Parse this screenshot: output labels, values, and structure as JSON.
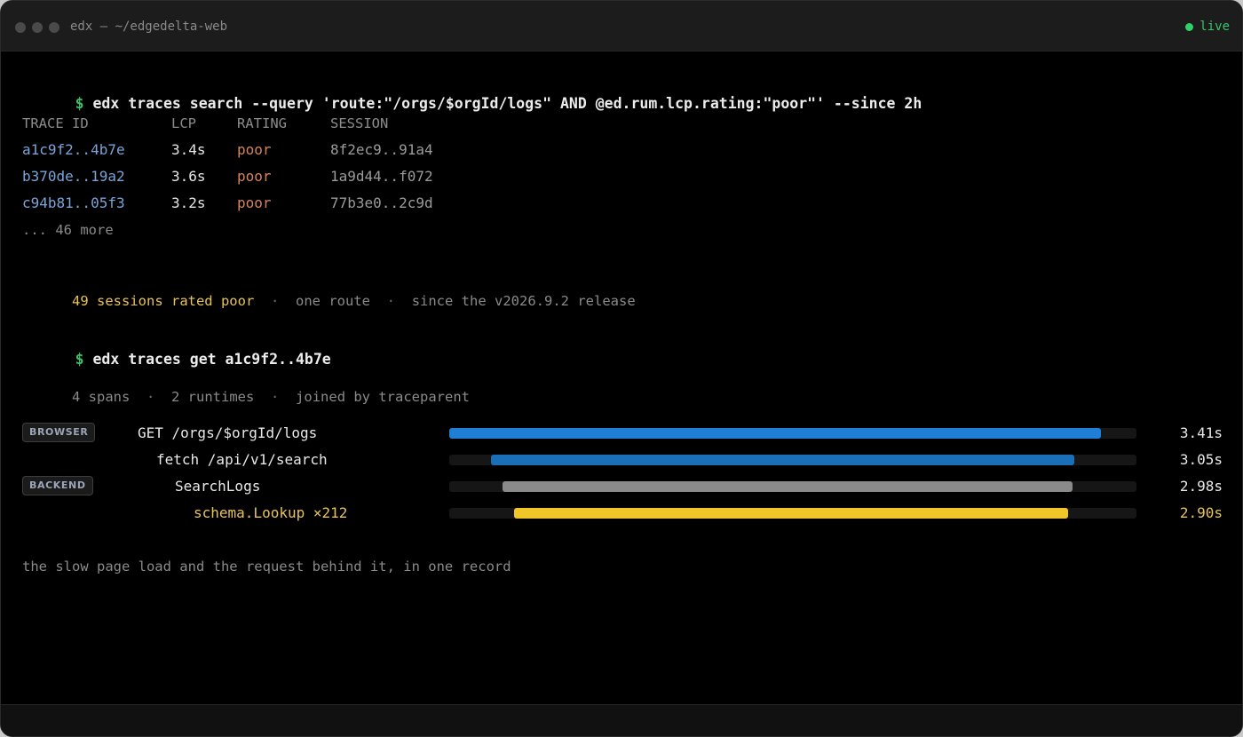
{
  "window": {
    "title": "edx — ~/edgedelta-web",
    "status": "live",
    "status_color": "#2fd06a"
  },
  "command1": {
    "prompt": "$",
    "text": "edx traces search --query 'route:\"/orgs/$orgId/logs\" AND @ed.rum.lcp.rating:\"poor\"' --since 2h"
  },
  "table": {
    "headers": [
      "TRACE ID",
      "LCP",
      "RATING",
      "SESSION"
    ],
    "rows": [
      {
        "trace_id": "a1c9f2..4b7e",
        "lcp": "3.4s",
        "rating": "poor",
        "session": "8f2ec9..91a4"
      },
      {
        "trace_id": "b370de..19a2",
        "lcp": "3.6s",
        "rating": "poor",
        "session": "1a9d44..f072"
      },
      {
        "trace_id": "c94b81..05f3",
        "lcp": "3.2s",
        "rating": "poor",
        "session": "77b3e0..2c9d"
      }
    ],
    "more": "... 46 more"
  },
  "summary1": {
    "highlight": "49 sessions rated poor",
    "sep": "·",
    "part2": "one route",
    "part3": "since the v2026.9.2 release"
  },
  "command2": {
    "prompt": "$",
    "text": "edx traces get a1c9f2..4b7e"
  },
  "summary2": {
    "part1": "4 spans",
    "sep": "·",
    "part2": "2 runtimes",
    "part3": "joined by traceparent"
  },
  "badges": {
    "browser": "BROWSER",
    "backend": "BACKEND"
  },
  "spans": [
    {
      "label": "GET /orgs/$orgId/logs",
      "duration": "3.41s",
      "start": 0.0,
      "end": 0.948,
      "color": "#1f7fd4",
      "label_color": "#e8e8e8",
      "dur_color": "#e8e8e8"
    },
    {
      "label": "fetch /api/v1/search",
      "duration": "3.05s",
      "start": 0.061,
      "end": 0.91,
      "color": "#1a6fb8",
      "label_color": "#e8e8e8",
      "dur_color": "#e8e8e8"
    },
    {
      "label": "SearchLogs",
      "duration": "2.98s",
      "start": 0.078,
      "end": 0.907,
      "color": "#8a8a8a",
      "label_color": "#e8e8e8",
      "dur_color": "#e8e8e8"
    },
    {
      "label": "schema.Lookup ×212",
      "duration": "2.90s",
      "start": 0.094,
      "end": 0.901,
      "color": "#f0c629",
      "label_color": "#e7c35a",
      "dur_color": "#e7c35a"
    }
  ],
  "caption": "the slow page load and the request behind it, in one record"
}
